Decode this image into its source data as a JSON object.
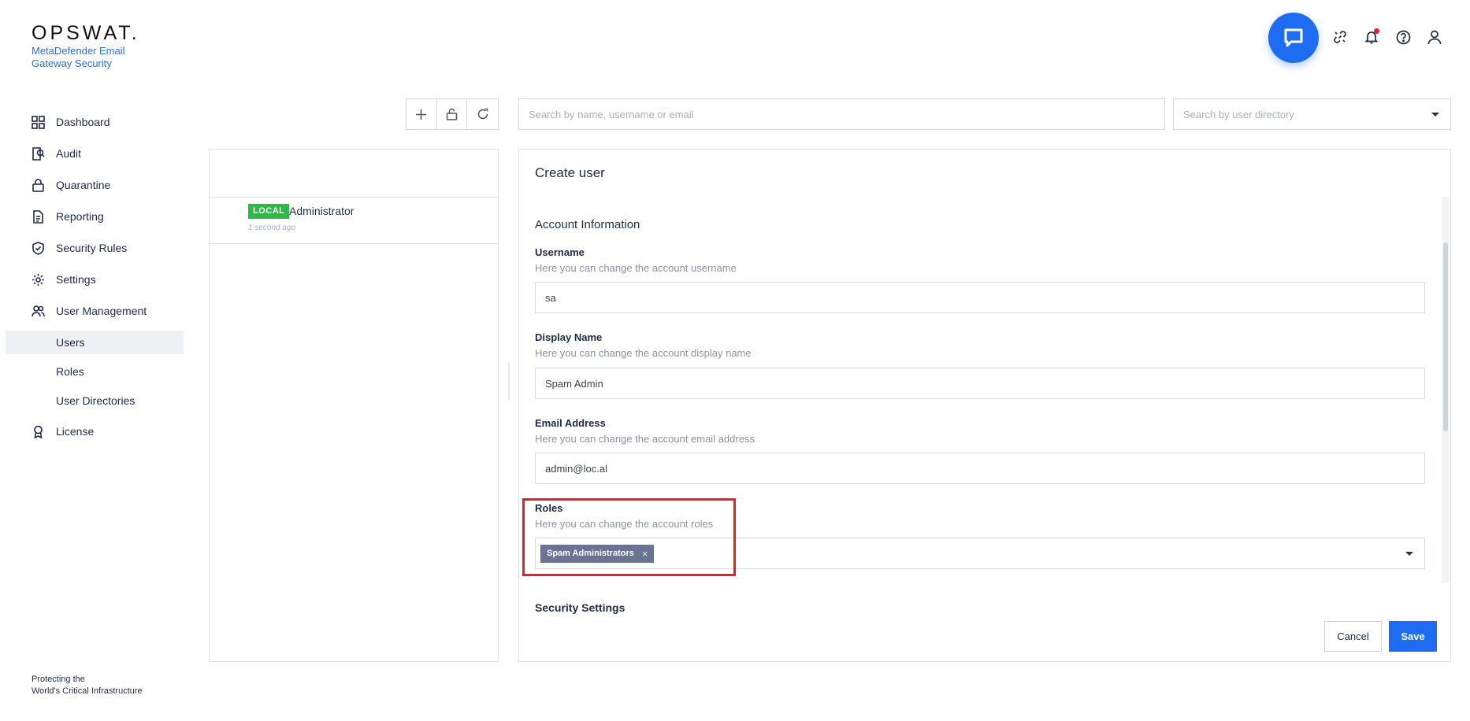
{
  "brand": {
    "logo": "OPSWAT.",
    "product": "MetaDefender Email Gateway Security",
    "footer_line1": "Protecting the",
    "footer_line2": "World's Critical Infrastructure"
  },
  "sidebar": {
    "items": [
      {
        "label": "Dashboard",
        "icon": "dashboard-grid-icon"
      },
      {
        "label": "Audit",
        "icon": "audit-icon"
      },
      {
        "label": "Quarantine",
        "icon": "lock-icon"
      },
      {
        "label": "Reporting",
        "icon": "document-icon"
      },
      {
        "label": "Security Rules",
        "icon": "shield-check-icon"
      },
      {
        "label": "Settings",
        "icon": "gear-icon"
      },
      {
        "label": "User Management",
        "icon": "users-icon"
      }
    ],
    "subitems": [
      {
        "label": "Users",
        "active": true
      },
      {
        "label": "Roles",
        "active": false
      },
      {
        "label": "User Directories",
        "active": false
      }
    ],
    "license": {
      "label": "License",
      "icon": "ribbon-icon"
    }
  },
  "topbar": {
    "icons": [
      "chat-icon",
      "link-icon",
      "bell-icon",
      "help-icon",
      "user-icon"
    ],
    "notification_color": "#e0202c"
  },
  "toolbar": {
    "search_placeholder": "Search by name, username or email",
    "directory_placeholder": "Search by user directory"
  },
  "user_list": {
    "users": [
      {
        "badge": "LOCAL",
        "name": "Administrator",
        "time": "1 second ago"
      }
    ]
  },
  "form": {
    "title": "Create user",
    "section_account": "Account Information",
    "username_label": "Username",
    "username_help": "Here you can change the account username",
    "username_value": "sa",
    "display_label": "Display Name",
    "display_help": "Here you can change the account display name",
    "display_value": "Spam Admin",
    "email_label": "Email Address",
    "email_help": "Here you can change the account email address",
    "email_value": "admin@loc.al",
    "roles_label": "Roles",
    "roles_help": "Here you can change the account roles",
    "roles": [
      "Spam Administrators"
    ],
    "section_security": "Security Settings",
    "cancel_label": "Cancel",
    "save_label": "Save"
  },
  "colors": {
    "accent": "#1d6cf2",
    "local_badge": "#2fb84a",
    "role_chip": "#6a7391",
    "highlight": "#e0202c"
  }
}
